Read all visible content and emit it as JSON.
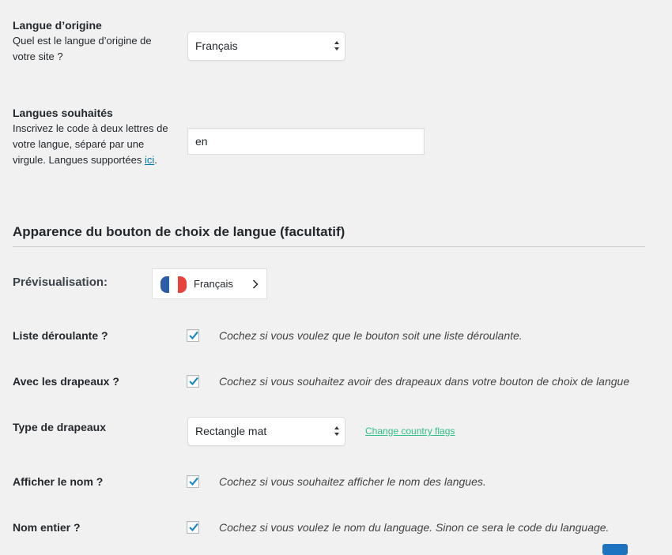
{
  "original_language": {
    "label": "Langue d’origine",
    "description": "Quel est le langue d’origine de votre site ?",
    "selected": "Français"
  },
  "wanted_languages": {
    "label": "Langues souhaités",
    "description_before": "Inscrivez le code à deux lettres de votre langue, séparé par une virgule. Langues supportées ",
    "link_text": "ici",
    "description_after": ".",
    "value": "en"
  },
  "appearance": {
    "section_title": "Apparence du bouton de choix de langue (facultatif)",
    "preview_label": "Prévisualisation:",
    "preview_language": "Français",
    "flag_colors": [
      "#2b5ea7",
      "#ffffff",
      "#e8423c"
    ],
    "dropdown": {
      "label": "Liste déroulante ?",
      "checked": true,
      "hint": "Cochez si vous voulez que le bouton soit une liste déroulante."
    },
    "flags": {
      "label": "Avec les drapeaux ?",
      "checked": true,
      "hint": "Cochez si vous souhaitez avoir des drapeaux dans votre bouton de choix de langue"
    },
    "flag_type": {
      "label": "Type de drapeaux",
      "selected": "Rectangle mat",
      "change_link": "Change country flags"
    },
    "show_name": {
      "label": "Afficher le nom ?",
      "checked": true,
      "hint": "Cochez si vous souhaitez afficher le nom des langues."
    },
    "full_name": {
      "label": "Nom entier ?",
      "checked": true,
      "hint": "Cochez si vous voulez le nom du language. Sinon ce sera le code du language."
    }
  },
  "colors": {
    "checkmark": "#1e8cbe",
    "link": "#0073aa",
    "change_link": "#2fbf8a"
  }
}
